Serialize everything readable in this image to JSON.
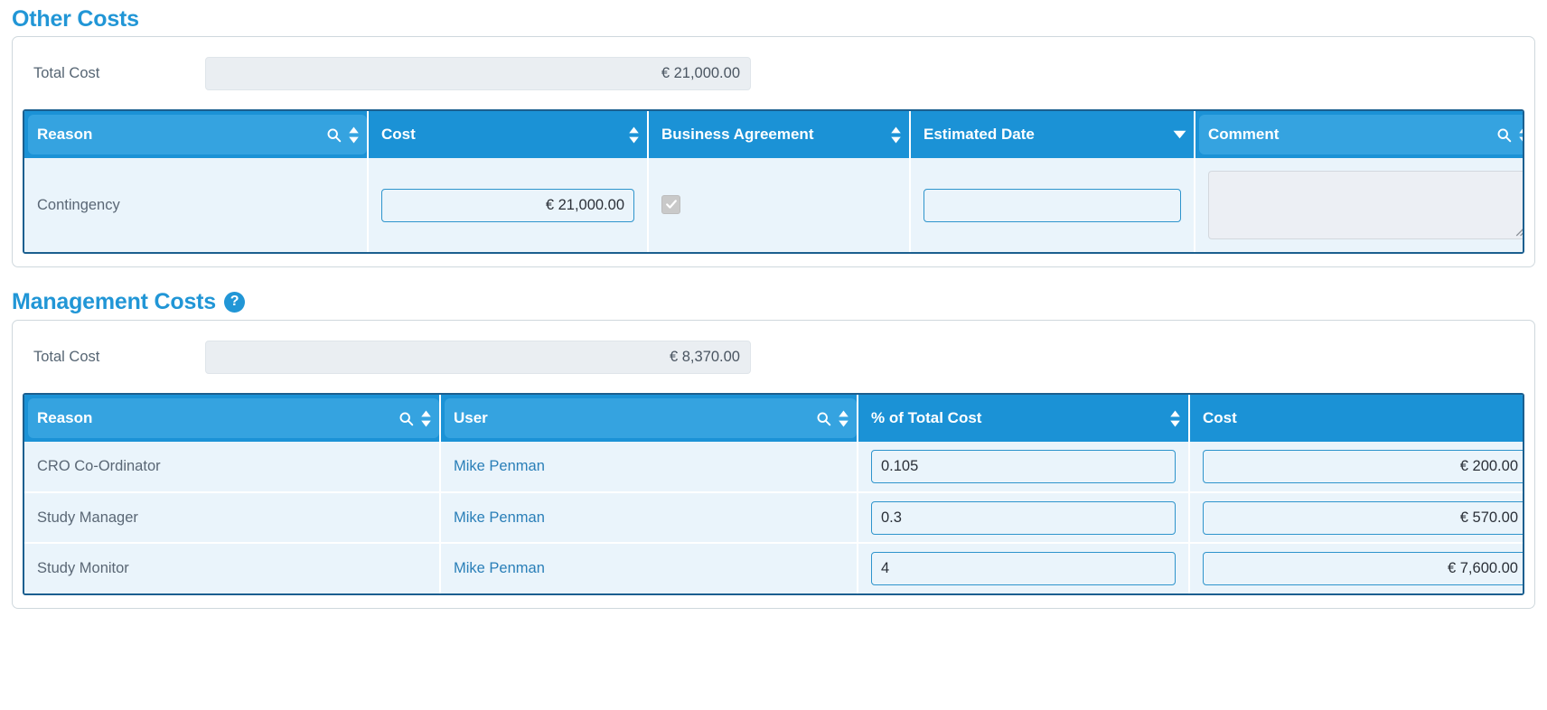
{
  "sections": [
    {
      "id": "other-costs",
      "title": "Other Costs",
      "has_help": false,
      "help_glyph": "",
      "total_label": "Total Cost",
      "total_value": "€ 21,000.00",
      "columns": [
        {
          "label": "Reason",
          "highlight": true,
          "search": true,
          "sort": "both"
        },
        {
          "label": "Cost",
          "highlight": false,
          "search": false,
          "sort": "both"
        },
        {
          "label": "Business Agreement",
          "highlight": false,
          "search": false,
          "sort": "both"
        },
        {
          "label": "Estimated Date",
          "highlight": false,
          "search": false,
          "sort": "desc"
        },
        {
          "label": "Comment",
          "highlight": true,
          "search": true,
          "sort": "both"
        }
      ],
      "rows": [
        {
          "reason": "Contingency",
          "cost": "€ 21,000.00",
          "business_agreement_checked": true,
          "estimated_date": "",
          "comment": ""
        }
      ]
    },
    {
      "id": "management-costs",
      "title": "Management Costs",
      "has_help": true,
      "help_glyph": "?",
      "total_label": "Total Cost",
      "total_value": "€ 8,370.00",
      "columns": [
        {
          "label": "Reason",
          "highlight": true,
          "search": true,
          "sort": "both"
        },
        {
          "label": "User",
          "highlight": true,
          "search": true,
          "sort": "both"
        },
        {
          "label": "% of Total Cost",
          "highlight": false,
          "search": false,
          "sort": "both"
        },
        {
          "label": "Cost",
          "highlight": false,
          "search": false,
          "sort": "both"
        }
      ],
      "rows": [
        {
          "reason": "CRO Co-Ordinator",
          "user": "Mike Penman",
          "percent": "0.105",
          "cost": "€ 200.00"
        },
        {
          "reason": "Study Manager",
          "user": "Mike Penman",
          "percent": "0.3",
          "cost": "€ 570.00"
        },
        {
          "reason": "Study Monitor",
          "user": "Mike Penman",
          "percent": "4",
          "cost": "€ 7,600.00"
        }
      ]
    }
  ],
  "icons": {
    "search": "search-icon",
    "sort": "sort-both-icon",
    "sort_desc": "sort-desc-icon",
    "check": "check-icon",
    "resize": "resize-handle-icon",
    "help": "help-icon"
  },
  "colors": {
    "accent": "#2196d6",
    "header_bg": "#1b92d6",
    "header_highlight": "#35a3e0",
    "row_bg": "#eaf4fb",
    "grid_border": "#1b5f8f",
    "input_border": "#2e94cc",
    "link": "#2a7fb8",
    "text": "#566573",
    "readonly_bg": "#eaeef2"
  }
}
